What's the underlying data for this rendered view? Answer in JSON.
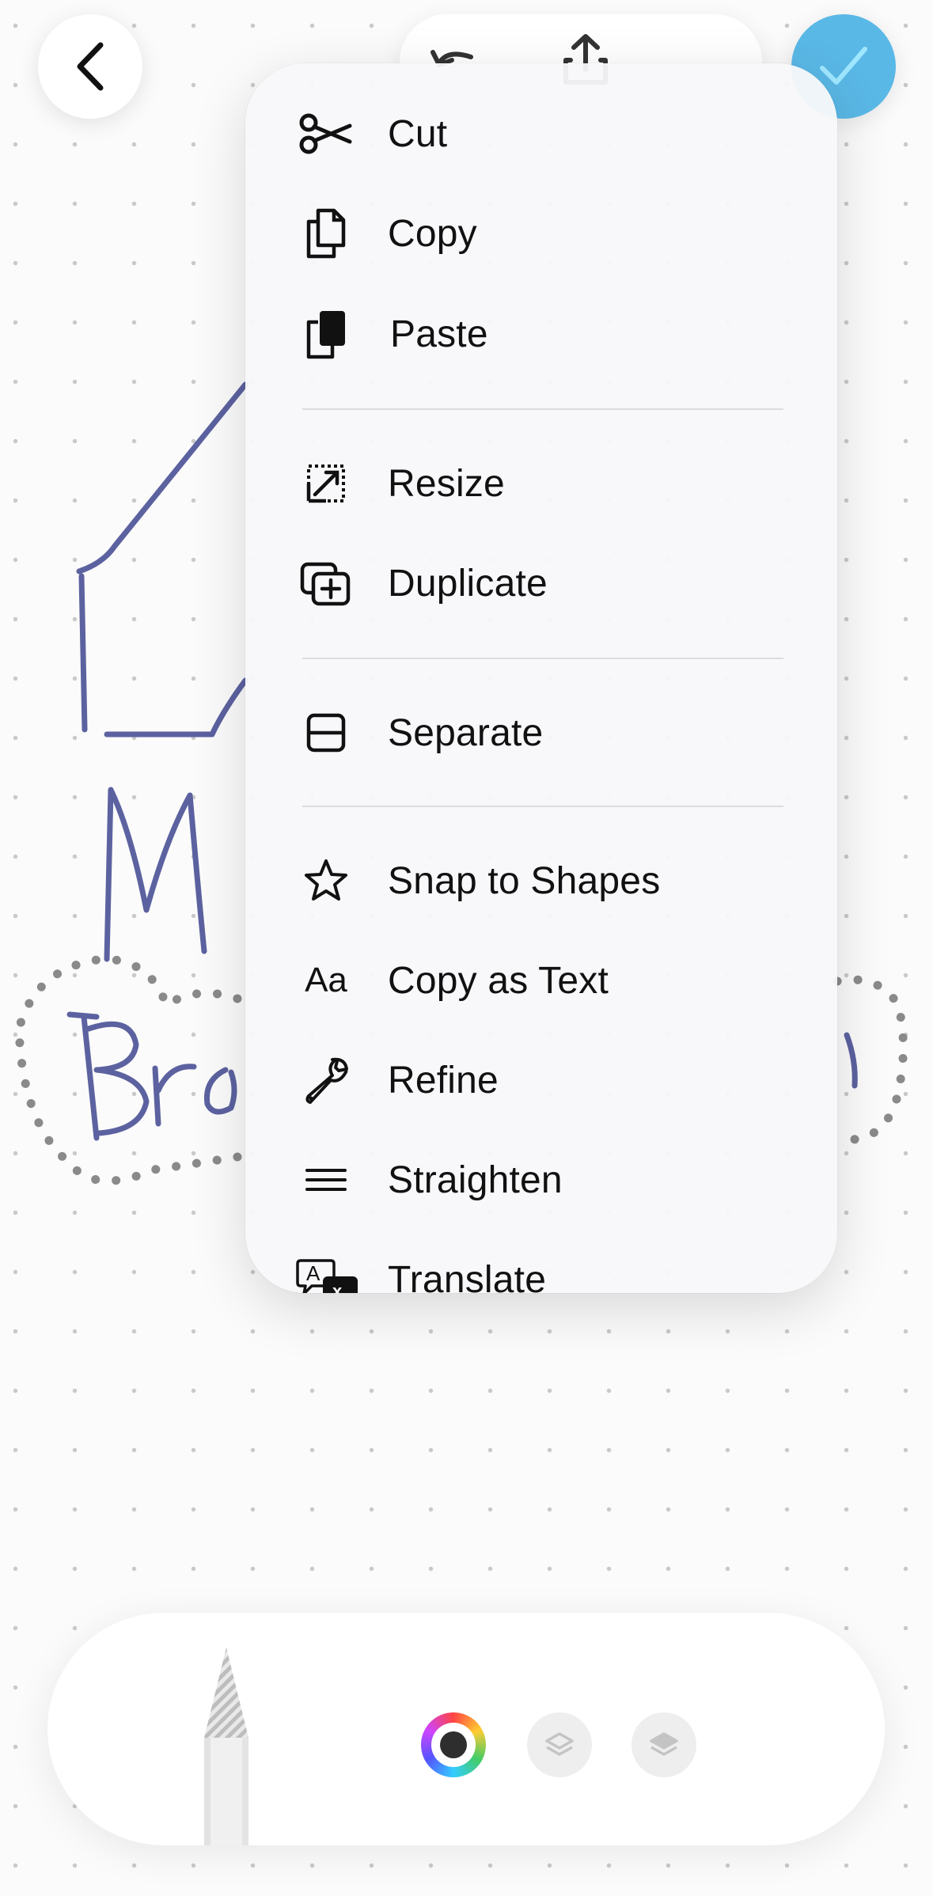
{
  "top_bar": {
    "back_icon": "chevron-left-icon",
    "undo_icon": "undo-icon",
    "share_icon": "share-icon",
    "done_icon": "checkmark-icon",
    "done_color": "#5ab8e6"
  },
  "canvas": {
    "ink_color": "#5c62a0",
    "handwriting": {
      "letter_m": "M",
      "word_partial": "Bro"
    }
  },
  "context_menu": {
    "items": [
      {
        "label": "Cut",
        "icon": "scissors-icon"
      },
      {
        "label": "Copy",
        "icon": "copy-icon"
      },
      {
        "label": "Paste",
        "icon": "paste-icon"
      },
      {
        "label": "Resize",
        "icon": "resize-icon"
      },
      {
        "label": "Duplicate",
        "icon": "duplicate-icon"
      },
      {
        "label": "Separate",
        "icon": "separate-icon"
      },
      {
        "label": "Snap to Shapes",
        "icon": "star-icon"
      },
      {
        "label": "Copy as Text",
        "icon": "aa-icon",
        "icon_text": "Aa"
      },
      {
        "label": "Refine",
        "icon": "wrench-icon"
      },
      {
        "label": "Straighten",
        "icon": "lines-icon"
      },
      {
        "label": "Translate",
        "icon": "translate-icon"
      }
    ]
  },
  "bottom_bar": {
    "pencil_icon": "pencil-icon",
    "color_picker_icon": "color-wheel-icon",
    "layer_icons": [
      "layers-icon",
      "layers-icon"
    ]
  }
}
